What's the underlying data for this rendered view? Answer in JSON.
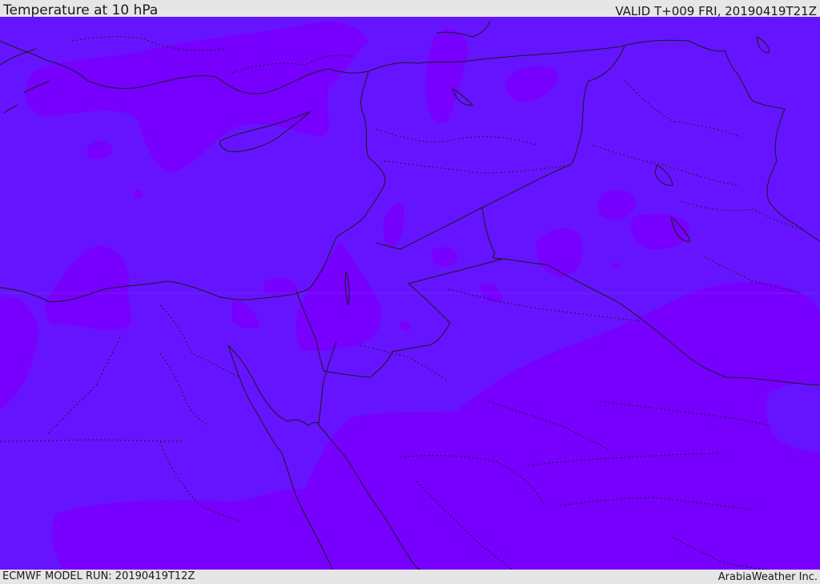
{
  "header": {
    "title": "Temperature at 10 hPa",
    "valid_time": "VALID T+009 FRI, 20190419T21Z"
  },
  "footer": {
    "model_run": "ECMWF MODEL RUN: 20190419T12Z",
    "credit": "ArabiaWeather Inc."
  },
  "map": {
    "field_colors": {
      "base": "#6614ff",
      "warmer": "#7700ff"
    },
    "coastline_color": "#1a1a1a",
    "border_color": "#1a1a1a"
  }
}
